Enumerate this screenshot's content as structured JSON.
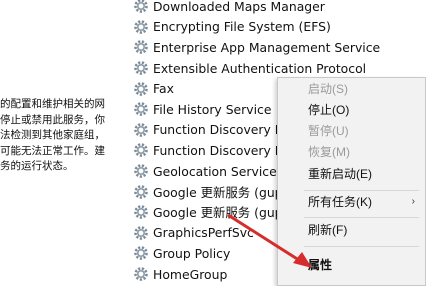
{
  "description_lines": [
    "的配置和维护相关的网",
    "停止或禁用此服务，你",
    "法检测到其他家庭组，",
    "可能无法正常工作。建",
    "务的运行状态。"
  ],
  "services": [
    {
      "label": "Downloaded Maps Manager"
    },
    {
      "label": "Encrypting File System (EFS)"
    },
    {
      "label": "Enterprise App Management Service"
    },
    {
      "label": "Extensible Authentication Protocol"
    },
    {
      "label": "Fax"
    },
    {
      "label": "File History Service"
    },
    {
      "label": "Function Discovery Pr"
    },
    {
      "label": "Function Discovery Re"
    },
    {
      "label": "Geolocation Service"
    },
    {
      "label": "Google 更新服务 (gup"
    },
    {
      "label": "Google 更新服务 (gup"
    },
    {
      "label": "GraphicsPerfSvc"
    },
    {
      "label": "Group Policy"
    },
    {
      "label": "HomeGroup"
    }
  ],
  "context_menu": {
    "start": "启动(S)",
    "stop": "停止(O)",
    "pause": "暂停(U)",
    "resume": "恢复(M)",
    "restart": "重新启动(E)",
    "all_tasks": "所有任务(K)",
    "refresh": "刷新(F)",
    "properties": "属性"
  },
  "colors": {
    "menu_bg": "#f2f2f2",
    "annotation_arrow": "#d62c2c",
    "gear_icon": "#7a8c9a"
  }
}
